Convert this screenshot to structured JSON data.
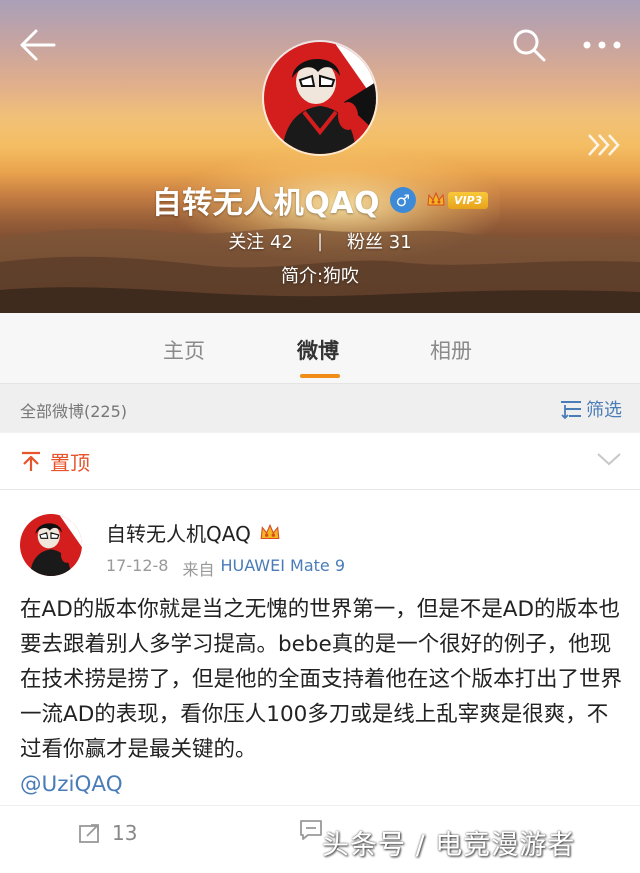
{
  "profile": {
    "name": "自转无人机QAQ",
    "gender_symbol": "♂",
    "vip_label": "VIP3",
    "following_label": "关注",
    "following_count": "42",
    "stats_separator": "|",
    "followers_label": "粉丝",
    "followers_count": "31",
    "bio": "简介:狗吹"
  },
  "tabs": [
    {
      "label": "主页"
    },
    {
      "label": "微博"
    },
    {
      "label": "相册"
    }
  ],
  "filter_bar": {
    "count_text": "全部微博(225)",
    "filter_label": "筛选"
  },
  "pinned": {
    "label": "置顶"
  },
  "post": {
    "author": "自转无人机QAQ",
    "date": "17-12-8",
    "source_prefix": "来自",
    "device": "HUAWEI Mate 9",
    "text": "在AD的版本你就是当之无愧的世界第一，但是不是AD的版本也要去跟着别人多学习提高。bebe真的是一个很好的例子，他现在技术捞是捞了，但是他的全面支持着他在这个版本打出了世界一流AD的表现，看你压人100多刀或是线上乱宰爽是很爽，不过看你赢才是最关键的。",
    "mention": "@UziQAQ",
    "repost_count": "13"
  },
  "watermark": "头条号 / 电竞漫游者",
  "colors": {
    "accent_orange": "#f08c1a",
    "link_blue": "#4a7cb8",
    "pin_red": "#e8542b"
  },
  "icons": [
    "back-arrow-icon",
    "search-icon",
    "more-icon",
    "chevrons-right-icon",
    "gender-male-icon",
    "vip-crown-icon",
    "filter-icon",
    "pin-icon",
    "chevron-down-icon",
    "repost-icon",
    "comment-icon"
  ]
}
